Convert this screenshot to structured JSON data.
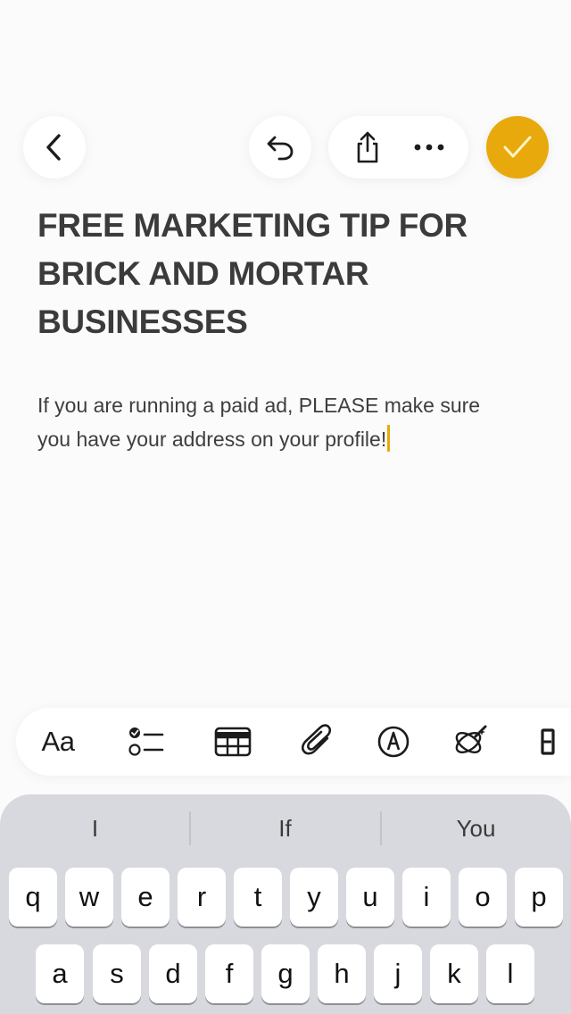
{
  "toolbar": {
    "back_icon": "chevron-left-icon",
    "undo_icon": "undo-icon",
    "share_icon": "share-icon",
    "more_icon": "ellipsis-icon",
    "done_icon": "checkmark-icon",
    "accent_color": "#e8a90d"
  },
  "note": {
    "title_lines": [
      "FREE MARKETING TIP FOR",
      "BRICK AND MORTAR",
      "BUSINESSES"
    ],
    "body_lines": [
      "If you are running a paid ad, PLEASE make sure",
      "you have your address on your profile!"
    ]
  },
  "format_bar": {
    "text_style_label": "Aa",
    "checklist_icon": "checklist-icon",
    "table_icon": "table-icon",
    "attachment_icon": "paperclip-icon",
    "markup_icon": "pen-circle-icon",
    "ai_icon": "sparkle-pen-icon"
  },
  "keyboard": {
    "suggestions": [
      "I",
      "If",
      "You"
    ],
    "rows": [
      [
        "q",
        "w",
        "e",
        "r",
        "t",
        "y",
        "u",
        "i",
        "o",
        "p"
      ],
      [
        "a",
        "s",
        "d",
        "f",
        "g",
        "h",
        "j",
        "k",
        "l"
      ]
    ]
  }
}
